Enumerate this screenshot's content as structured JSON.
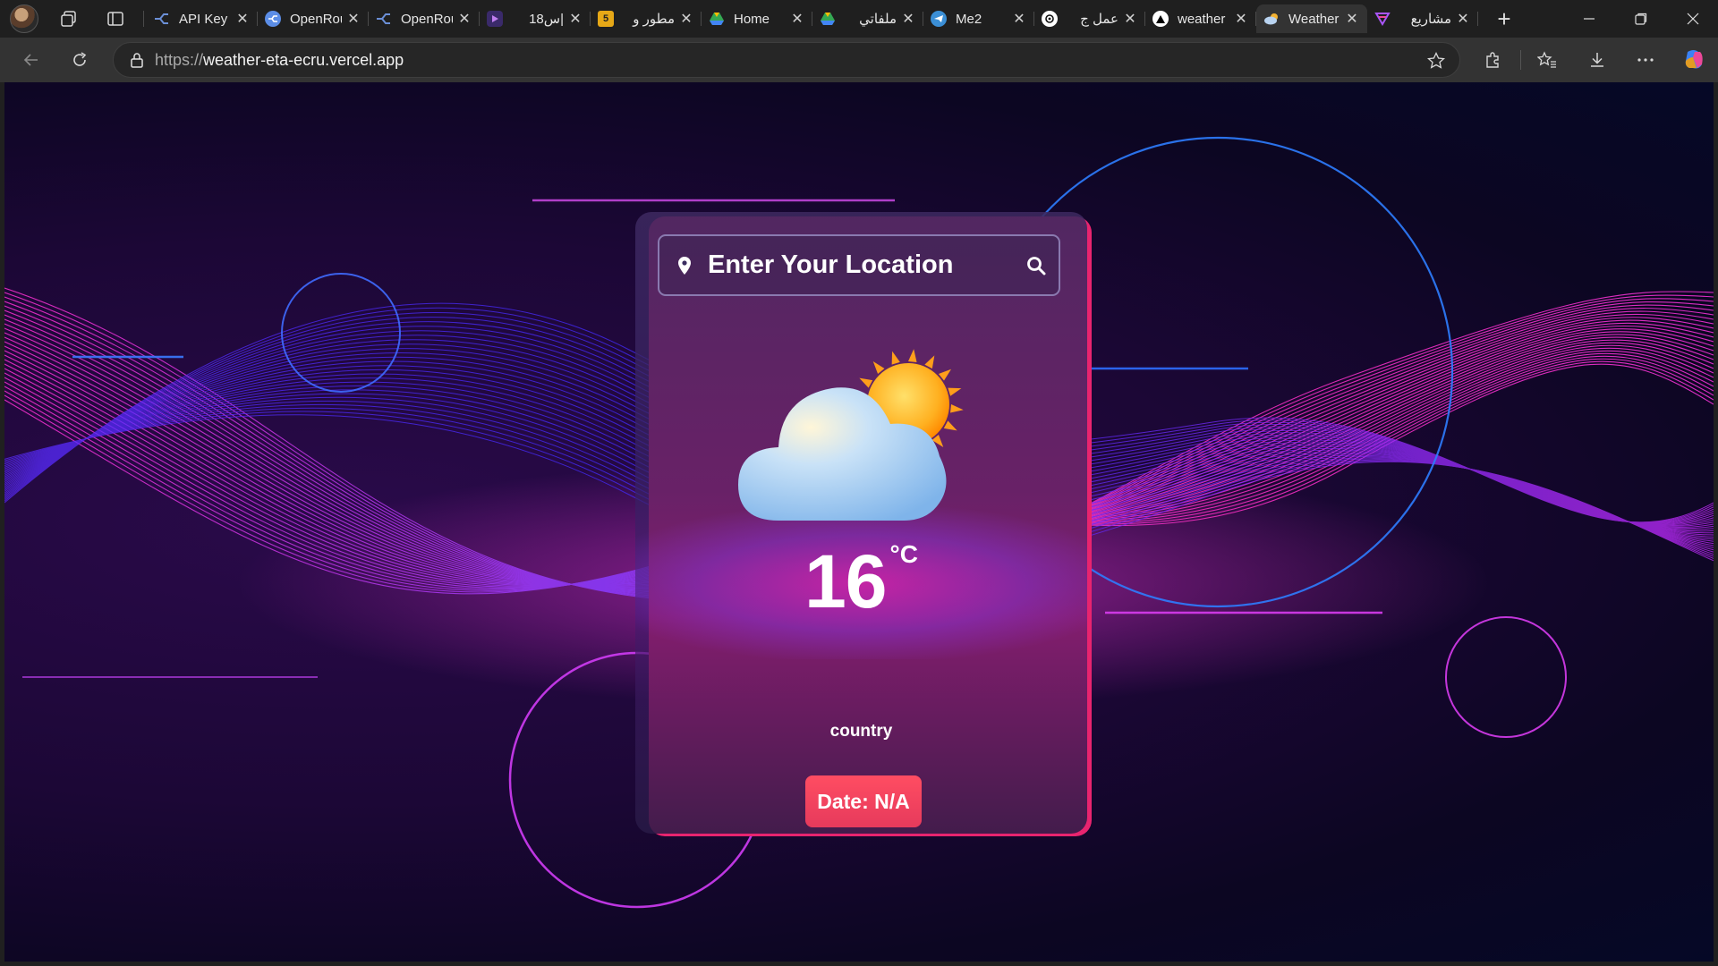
{
  "browser": {
    "tabs": [
      {
        "label": "API Key",
        "favicon": "openrouter-icon",
        "favicon_color": "#6b8fd6",
        "active": false
      },
      {
        "label": "OpenRouter",
        "favicon": "openrouter-icon",
        "favicon_color": "#5b8de6",
        "active": false
      },
      {
        "label": "OpenRouter",
        "favicon": "openrouter-icon",
        "favicon_color": "#6b8fd6",
        "active": false
      },
      {
        "label": "س18|",
        "favicon": "video-icon",
        "favicon_color": "#7a3db8",
        "active": false
      },
      {
        "label": "مطور و",
        "favicon": "number-five-icon",
        "favicon_color": "#e6a817",
        "favicon_text": "5",
        "active": false
      },
      {
        "label": "Home",
        "favicon": "google-drive-icon",
        "favicon_color": "#34a853",
        "active": false
      },
      {
        "label": "ملفاتي",
        "favicon": "google-drive-icon",
        "favicon_color": "#fbbc05",
        "active": false
      },
      {
        "label": "Me2",
        "favicon": "telegram-icon",
        "favicon_color": "#3b8fd6",
        "active": false
      },
      {
        "label": "عمل ج",
        "favicon": "chatgpt-icon",
        "favicon_color": "#ffffff",
        "active": false
      },
      {
        "label": "weather",
        "favicon": "vercel-icon",
        "favicon_color": "#000000",
        "active": false
      },
      {
        "label": "Weather",
        "favicon": "weather-icon",
        "favicon_color": "#9fb7d8",
        "active": true
      },
      {
        "label": "مشاريع",
        "favicon": "arrow-logo-icon",
        "favicon_color": "#8b5cf6",
        "active": false
      }
    ],
    "address": {
      "scheme": "https://",
      "host": "weather-eta-ecru.vercel.app"
    }
  },
  "app": {
    "search": {
      "placeholder": "Enter Your Location",
      "pin_icon": "location-pin-icon",
      "search_icon": "search-icon"
    },
    "weather": {
      "icon": "partly-cloudy-icon",
      "temperature": "16",
      "unit": "°C",
      "location": "country",
      "date_label": "Date: N/A"
    },
    "colors": {
      "accent": "#e8246f",
      "date_button": "#f2424f",
      "background": "#1c0736"
    }
  }
}
